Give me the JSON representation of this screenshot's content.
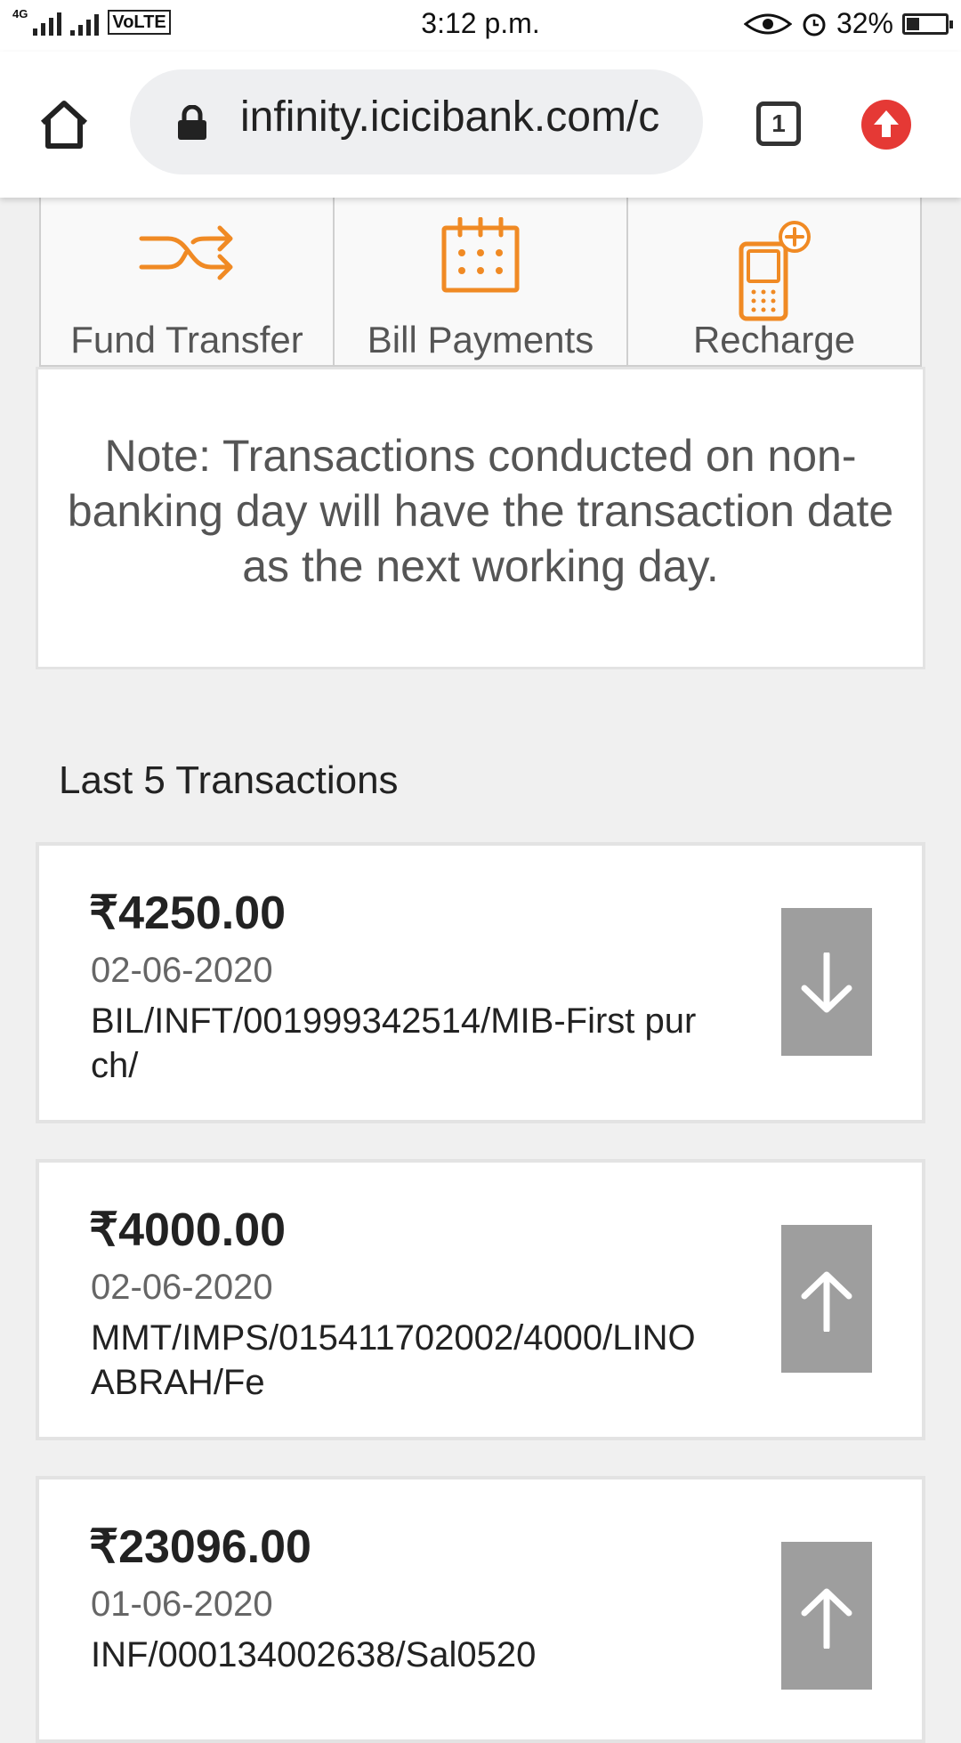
{
  "status_bar": {
    "network": "4G",
    "volte": "VoLTE",
    "time": "3:12 p.m.",
    "battery": "32%",
    "icons": [
      "signal-icon",
      "eye-icon",
      "alarm-icon",
      "battery-icon"
    ]
  },
  "browser": {
    "url": "infinity.icicibank.com/c",
    "tab_count": "1",
    "icons": [
      "home-icon",
      "lock-icon",
      "tabs-icon",
      "update-icon"
    ]
  },
  "quick_actions": [
    {
      "label": "Fund Transfer",
      "icon": "shuffle-icon"
    },
    {
      "label": "Bill Payments",
      "icon": "calendar-icon"
    },
    {
      "label": "Recharge",
      "icon": "mobile-recharge-icon"
    }
  ],
  "note": "Note: Transactions conducted on non-banking day will have the transaction date as the next working day.",
  "transactions_title": "Last 5 Transactions",
  "transactions": [
    {
      "amount": "₹4250.00",
      "date": "02-06-2020",
      "description": "BIL/INFT/001999342514/MIB-First purch/",
      "direction": "down"
    },
    {
      "amount": "₹4000.00",
      "date": "02-06-2020",
      "description": "MMT/IMPS/015411702002/4000/LINO ABRAH/Fe",
      "direction": "up"
    },
    {
      "amount": "₹23096.00",
      "date": "01-06-2020",
      "description": "INF/000134002638/Sal0520",
      "direction": "up"
    }
  ],
  "colors": {
    "accent_orange": "#f08a24",
    "arrow_bg": "#9e9e9e",
    "update_red": "#e53935"
  }
}
